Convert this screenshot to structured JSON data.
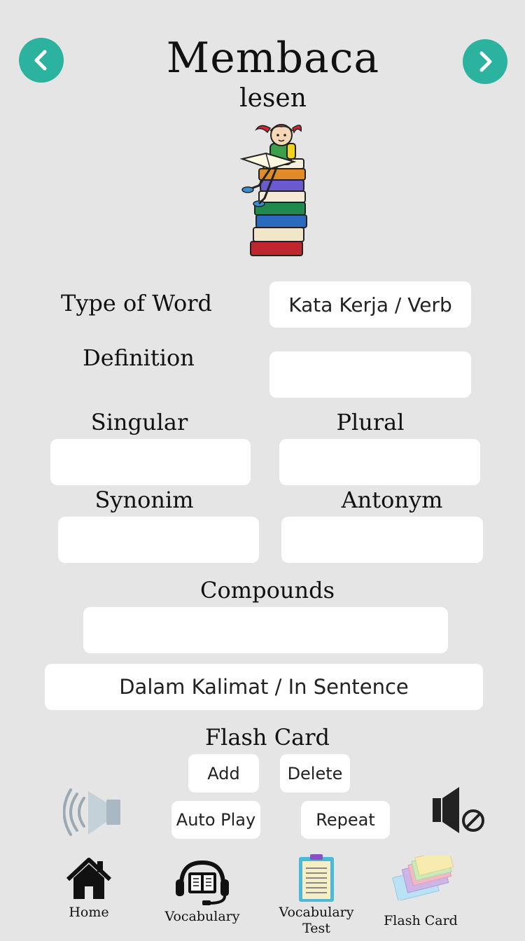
{
  "header": {
    "title": "Membaca",
    "subtitle": "lesen"
  },
  "colors": {
    "accent": "#2bb3a0",
    "background": "#e5e5e5",
    "field": "#ffffff"
  },
  "fields": {
    "type_of_word": {
      "label": "Type of Word",
      "value": "Kata Kerja / Verb"
    },
    "definition": {
      "label": "Definition",
      "value": ""
    },
    "singular": {
      "label": "Singular",
      "value": ""
    },
    "plural": {
      "label": "Plural",
      "value": ""
    },
    "synonim": {
      "label": "Synonim",
      "value": ""
    },
    "antonym": {
      "label": "Antonym",
      "value": ""
    },
    "compounds": {
      "label": "Compounds",
      "value": ""
    },
    "in_sentence": {
      "value": "Dalam Kalimat / In Sentence"
    }
  },
  "flash_card": {
    "title": "Flash Card",
    "add_label": "Add",
    "delete_label": "Delete",
    "auto_play_label": "Auto Play",
    "repeat_label": "Repeat"
  },
  "nav": {
    "home": "Home",
    "vocabulary": "Vocabulary",
    "vocabulary_test_line1": "Vocabulary",
    "vocabulary_test_line2": "Test",
    "flash_card": "Flash Card"
  },
  "icons": {
    "prev": "chevron-left-icon",
    "next": "chevron-right-icon",
    "illustration": "girl-reading-on-books",
    "speaker_on": "speaker-icon",
    "speaker_mute": "mute-icon",
    "home": "home-icon",
    "vocabulary": "headset-book-icon",
    "vocabulary_test": "clipboard-icon",
    "flash_card": "index-cards-icon"
  }
}
